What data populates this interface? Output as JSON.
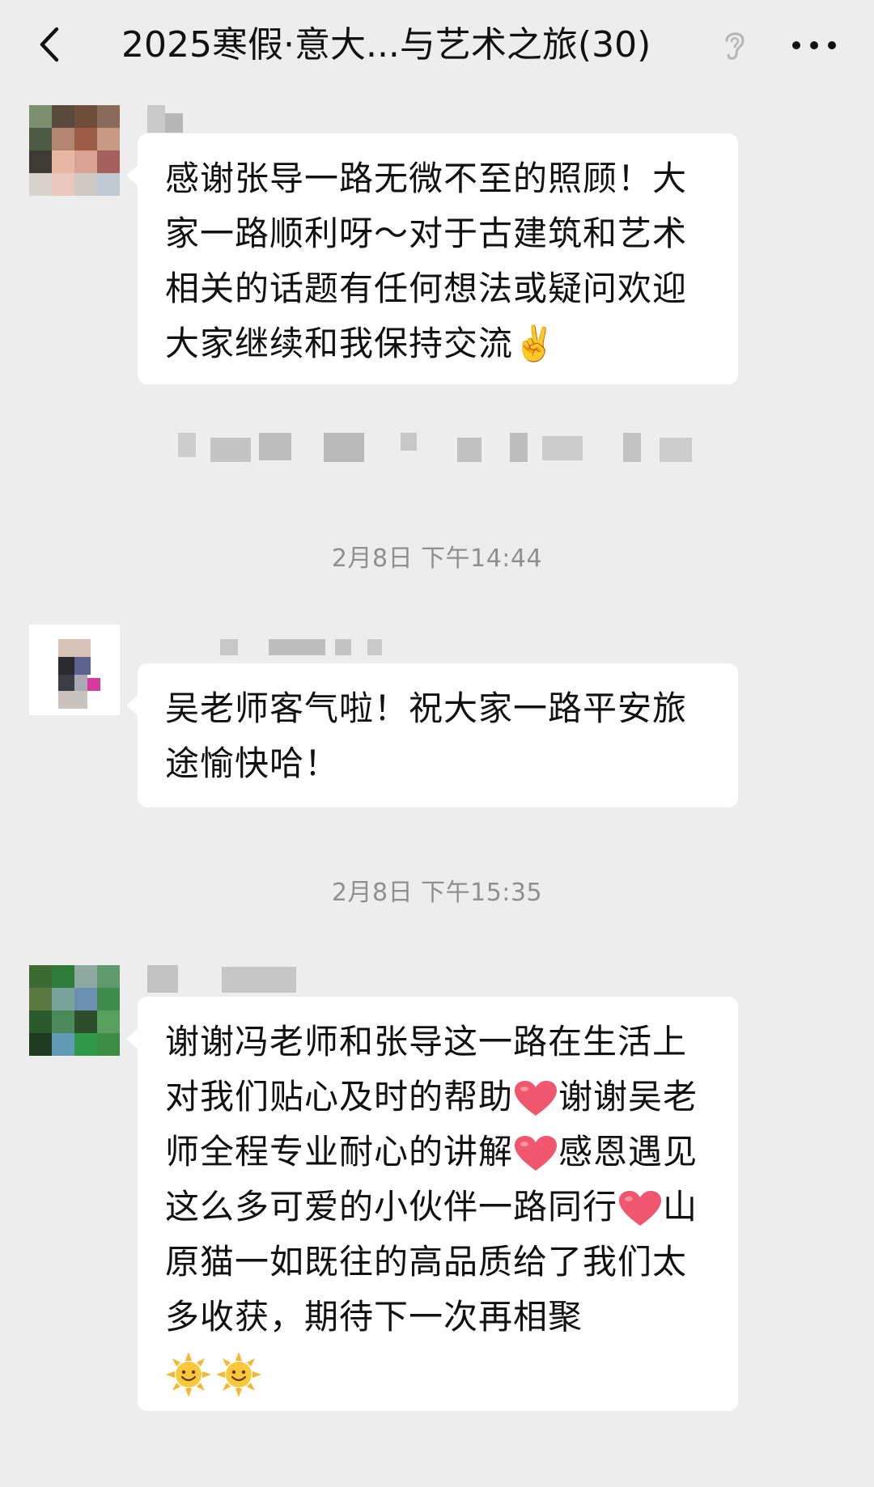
{
  "header": {
    "title": "2025寒假·意大...与艺术之旅(30)"
  },
  "messages": [
    {
      "text": "感谢张导一路无微不至的照顾！大家一路顺利呀～对于古建筑和艺术相关的话题有任何想法或疑问欢迎大家继续和我保持交流✌️"
    },
    {
      "timestamp": "2月8日 下午14:44",
      "text": "吴老师客气啦！祝大家一路平安旅途愉快哈！"
    },
    {
      "timestamp": "2月8日 下午15:35",
      "text_parts": [
        "谢谢冯老师和张导这一路在生活上对我们贴心及时的帮助",
        "谢谢吴老师全程专业耐心的讲解",
        "感恩遇见这么多可爱的小伙伴一路同行",
        "山原猫一如既往的高品质给了我们太多收获，期待下一次再相聚"
      ]
    }
  ],
  "icons": {
    "back": "chevron-left-icon",
    "listen": "ear-icon",
    "more": "ellipsis-icon",
    "heart": "red-heart-emoji",
    "sun": "smiling-sun-emoji",
    "victory": "victory-hand-emoji"
  },
  "colors": {
    "background": "#ededed",
    "bubble": "#ffffff",
    "timestamp": "#8f8f8f",
    "heart": "#f0566d",
    "sun": "#f7b531"
  }
}
